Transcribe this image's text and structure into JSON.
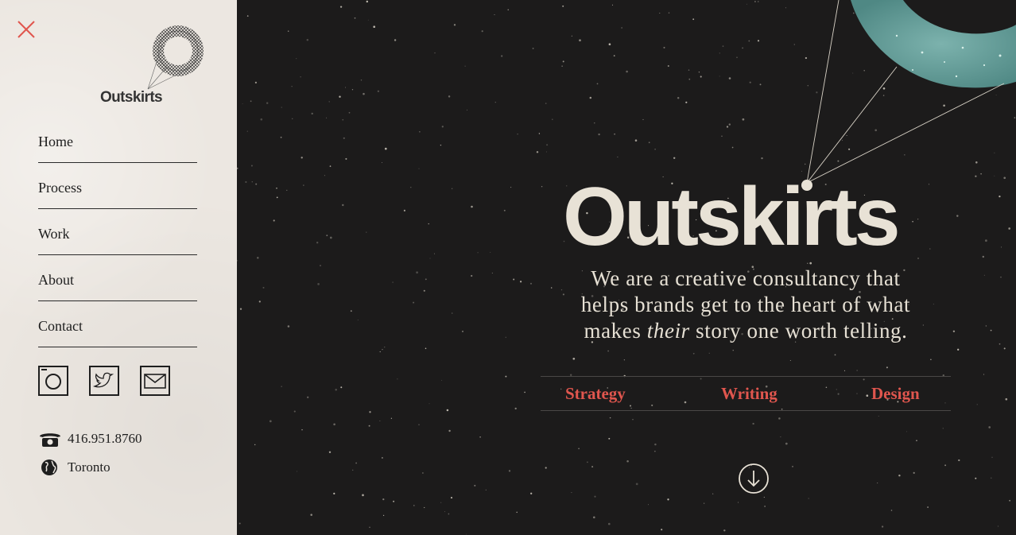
{
  "brand": {
    "name": "Outskirts"
  },
  "sidebar": {
    "close_icon": "close-icon",
    "nav": [
      {
        "label": "Home"
      },
      {
        "label": "Process"
      },
      {
        "label": "Work"
      },
      {
        "label": "About"
      },
      {
        "label": "Contact"
      }
    ],
    "socials": [
      {
        "icon": "instagram-icon"
      },
      {
        "icon": "twitter-icon"
      },
      {
        "icon": "email-icon"
      }
    ],
    "phone": "416.951.8760",
    "location": "Toronto"
  },
  "hero": {
    "title": "Outskirts",
    "tagline_line1": "We are a creative consultancy that",
    "tagline_line2": "helps brands get to the heart of what",
    "tagline_line3_start": "makes ",
    "tagline_line3_em": "their",
    "tagline_line3_end": " story one worth telling.",
    "services": [
      "Strategy",
      "Writing",
      "Design"
    ],
    "scroll_icon": "arrow-down-circle-icon"
  },
  "colors": {
    "sidebar_bg": "#ece7e1",
    "hero_bg": "#1c1b1b",
    "accent": "#e0564e",
    "hero_text": "#e8e2d6",
    "planet": "#5f9a96"
  }
}
